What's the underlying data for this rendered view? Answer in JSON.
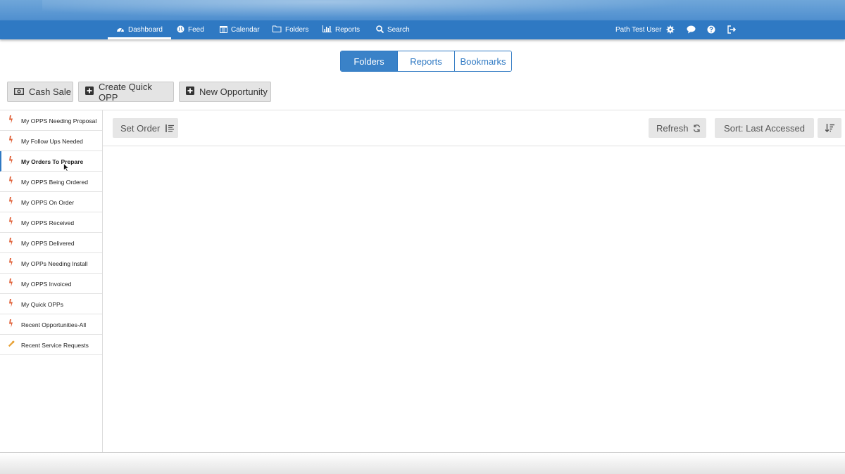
{
  "nav": {
    "items": [
      {
        "label": "Dashboard",
        "icon": "dashboard-icon",
        "active": true
      },
      {
        "label": "Feed",
        "icon": "globe-icon"
      },
      {
        "label": "Calendar",
        "icon": "calendar-icon"
      },
      {
        "label": "Folders",
        "icon": "folder-icon"
      },
      {
        "label": "Reports",
        "icon": "bar-chart-icon"
      },
      {
        "label": "Search",
        "icon": "search-icon"
      }
    ],
    "user_name": "Path Test User",
    "right_icons": [
      "gear-icon",
      "chat-icon",
      "help-icon",
      "logout-icon"
    ]
  },
  "tabs": [
    {
      "label": "Folders",
      "active": true
    },
    {
      "label": "Reports"
    },
    {
      "label": "Bookmarks"
    }
  ],
  "actions": {
    "cash_sale": "Cash Sale",
    "create_quick_opp": "Create Quick OPP",
    "new_opportunity": "New Opportunity"
  },
  "sidebar": {
    "items": [
      {
        "label": "My OPPS Needing Proposal",
        "icon": "lightning-icon"
      },
      {
        "label": "My Follow Ups Needed",
        "icon": "lightning-icon"
      },
      {
        "label": "My Orders To Prepare",
        "icon": "lightning-icon",
        "active": true
      },
      {
        "label": "My OPPS Being Ordered",
        "icon": "lightning-icon"
      },
      {
        "label": "My OPPS On Order",
        "icon": "lightning-icon"
      },
      {
        "label": "My OPPS Received",
        "icon": "lightning-icon"
      },
      {
        "label": "My OPPS Delivered",
        "icon": "lightning-icon"
      },
      {
        "label": "My OPPs Needing Install",
        "icon": "lightning-icon"
      },
      {
        "label": "My OPPS Invoiced",
        "icon": "lightning-icon"
      },
      {
        "label": "My Quick OPPs",
        "icon": "lightning-icon"
      },
      {
        "label": "Recent Opportunities-All",
        "icon": "lightning-icon"
      },
      {
        "label": "Recent Service Requests",
        "icon": "wrench-icon"
      }
    ]
  },
  "toolbar": {
    "set_order": "Set Order",
    "refresh": "Refresh",
    "sort": "Sort: Last Accessed"
  },
  "colors": {
    "brand": "#2f79c3",
    "lightning": "#e0623a",
    "wrench": "#e8a33a"
  }
}
